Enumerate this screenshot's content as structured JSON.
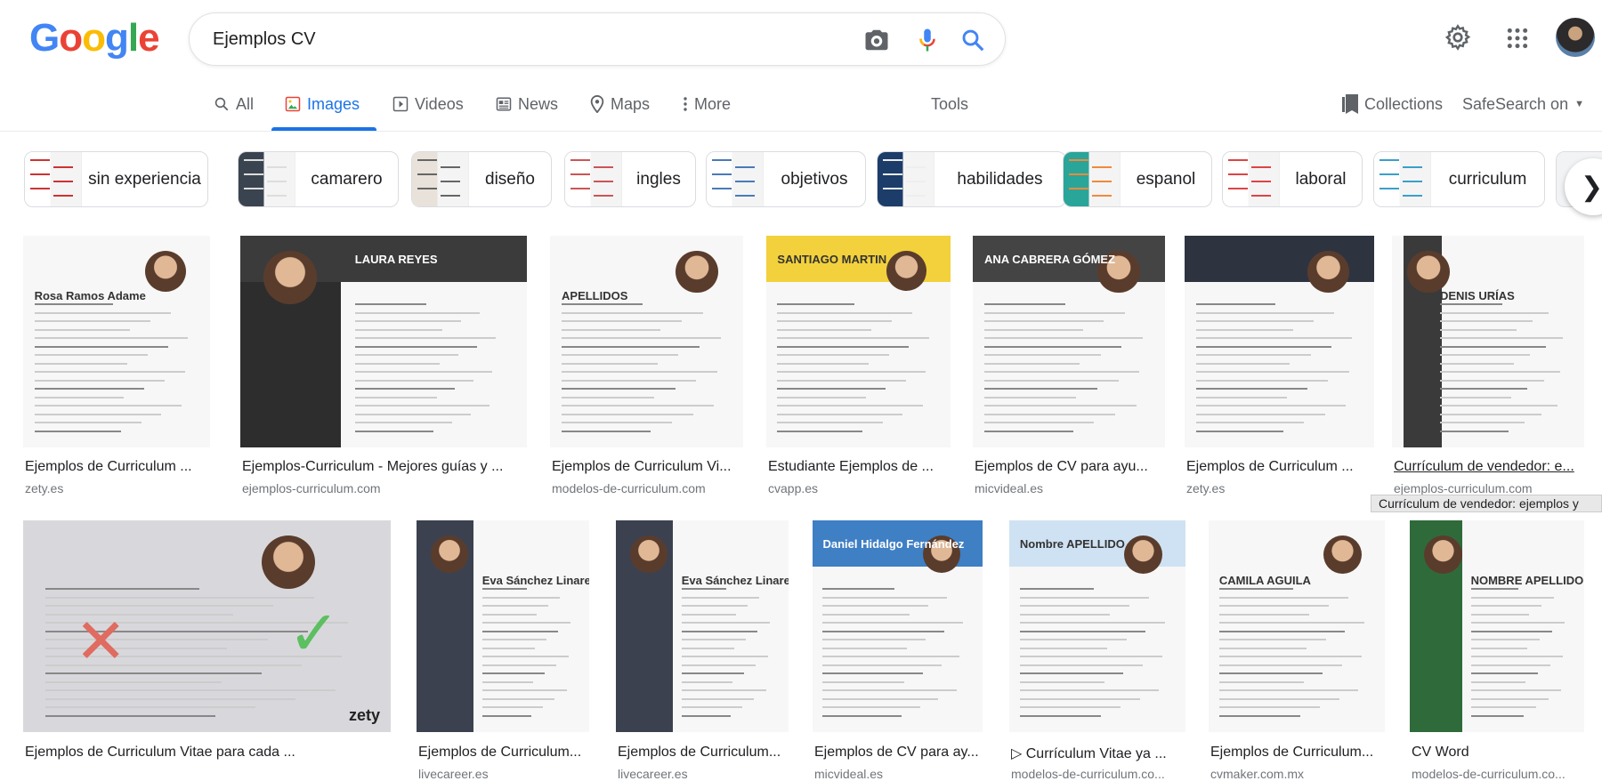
{
  "header": {
    "logo_letters": [
      {
        "ch": "G",
        "color": "#4285f4"
      },
      {
        "ch": "o",
        "color": "#ea4335"
      },
      {
        "ch": "o",
        "color": "#fbbc05"
      },
      {
        "ch": "g",
        "color": "#4285f4"
      },
      {
        "ch": "l",
        "color": "#34a853"
      },
      {
        "ch": "e",
        "color": "#ea4335"
      }
    ],
    "logo_text": "Google",
    "search_value": "Ejemplos CV",
    "icons": [
      "camera-icon",
      "microphone-icon",
      "search-icon",
      "settings-gear-icon",
      "apps-grid-icon",
      "avatar"
    ]
  },
  "tabs": {
    "items": [
      {
        "label": "All",
        "icon": "search-icon"
      },
      {
        "label": "Images",
        "icon": "image-icon",
        "active": true
      },
      {
        "label": "Videos",
        "icon": "play-icon"
      },
      {
        "label": "News",
        "icon": "news-icon"
      },
      {
        "label": "Maps",
        "icon": "pin-icon"
      },
      {
        "label": "More",
        "icon": "dots-vertical-icon"
      }
    ],
    "tools": "Tools",
    "collections": "Collections",
    "safesearch": "SafeSearch on"
  },
  "chips": [
    {
      "label": "sin experiencia"
    },
    {
      "label": "camarero"
    },
    {
      "label": "diseño"
    },
    {
      "label": "ingles"
    },
    {
      "label": "objetivos"
    },
    {
      "label": "habilidades"
    },
    {
      "label": "espanol"
    },
    {
      "label": "laboral"
    },
    {
      "label": "curriculum"
    }
  ],
  "results_row1": [
    {
      "title": "Ejemplos de Curriculum ...",
      "source": "zety.es",
      "cv_name": "Rosa Ramos Adame"
    },
    {
      "title": "Ejemplos-Curriculum - Mejores guías y ...",
      "source": "ejemplos-curriculum.com",
      "cv_name": "LAURA REYES"
    },
    {
      "title": "Ejemplos de Curriculum Vi...",
      "source": "modelos-de-curriculum.com",
      "cv_name": "APELLIDOS"
    },
    {
      "title": "Estudiante Ejemplos de ...",
      "source": "cvapp.es",
      "cv_name": "SANTIAGO MARTIN"
    },
    {
      "title": "Ejemplos de CV para ayu...",
      "source": "micvideal.es",
      "cv_name": "ANA CABRERA GÓMEZ"
    },
    {
      "title": "Ejemplos de Curriculum ...",
      "source": "zety.es",
      "cv_name": ""
    },
    {
      "title": "Currículum de vendedor: e...",
      "source": "ejemplos-curriculum.com",
      "cv_name": "DENIS URÍAS"
    }
  ],
  "tooltip": "Currículum de vendedor: ejemplos y",
  "results_row2": [
    {
      "title": "Ejemplos de Curriculum Vitae para cada ...",
      "source": "",
      "cv_name": "zety"
    },
    {
      "title": "Ejemplos de Curriculum...",
      "source": "livecareer.es",
      "cv_name": "Eva Sánchez Linares"
    },
    {
      "title": "Ejemplos de Curriculum...",
      "source": "livecareer.es",
      "cv_name": "Eva Sánchez Linares"
    },
    {
      "title": "Ejemplos de CV para ay...",
      "source": "micvideal.es",
      "cv_name": "Daniel Hidalgo Fernández"
    },
    {
      "title": "▷ Currículum Vitae ya ...",
      "source": "modelos-de-curriculum.co...",
      "cv_name": "Nombre APELLIDO"
    },
    {
      "title": "Ejemplos de Curriculum...",
      "source": "cvmaker.com.mx",
      "cv_name": "CAMILA AGUILA"
    },
    {
      "title": "CV Word",
      "source": "modelos-de-curriculum.co...",
      "cv_name": "NOMBRE APELLIDO"
    }
  ],
  "colors": {
    "accent": "#1a73e8",
    "text_secondary": "#5f6368",
    "source": "#70757a"
  }
}
